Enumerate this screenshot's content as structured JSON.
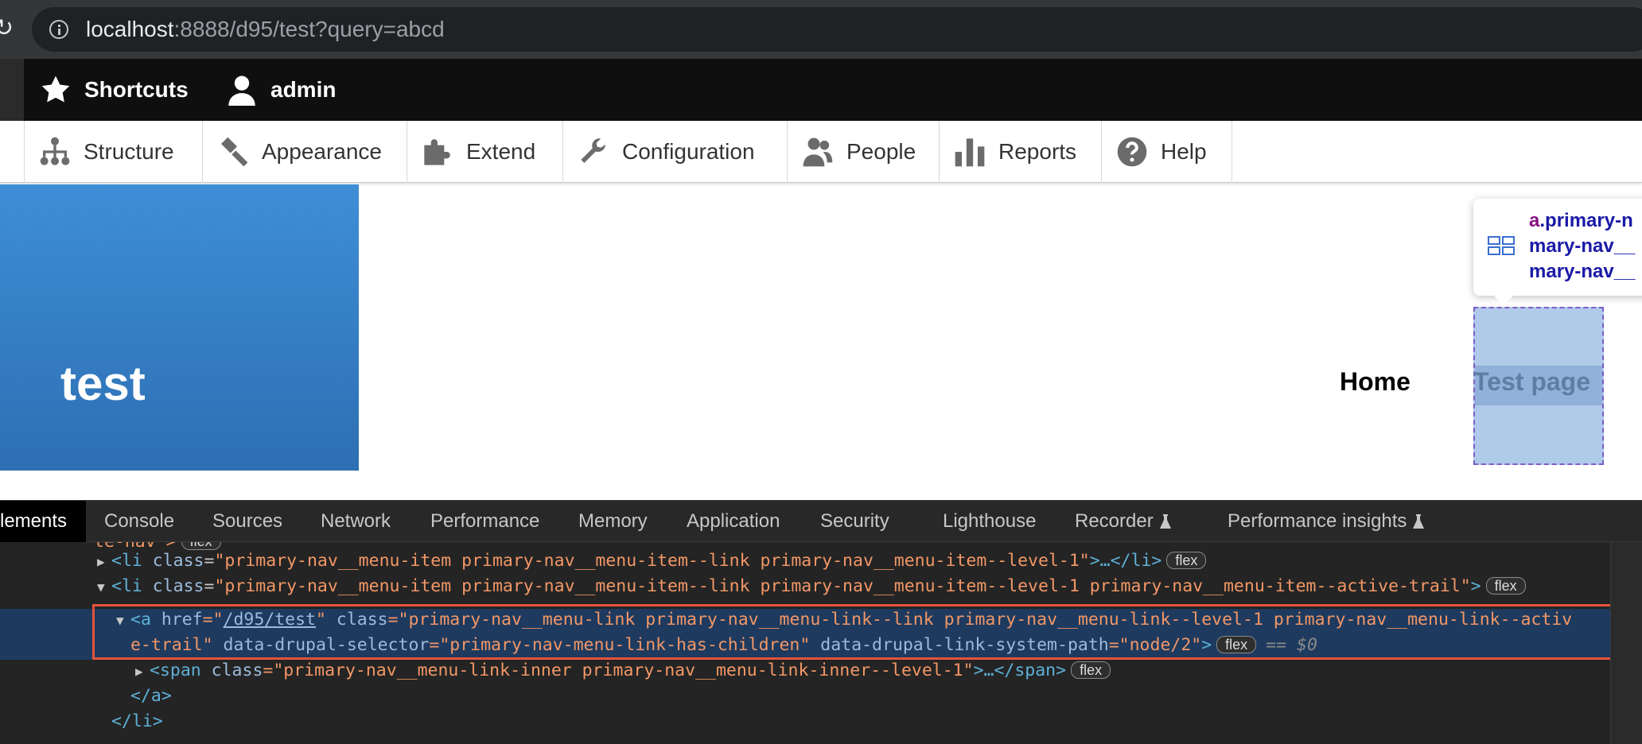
{
  "browser": {
    "url_host": "localhost",
    "url_rest": ":8888/d95/test?query=abcd"
  },
  "toolbar": {
    "shortcuts_label": "Shortcuts",
    "user_label": "admin"
  },
  "tray": {
    "items": [
      {
        "label": "Structure",
        "icon": "structure-icon"
      },
      {
        "label": "Appearance",
        "icon": "appearance-icon"
      },
      {
        "label": "Extend",
        "icon": "extend-icon"
      },
      {
        "label": "Configuration",
        "icon": "configuration-icon"
      },
      {
        "label": "People",
        "icon": "people-icon"
      },
      {
        "label": "Reports",
        "icon": "reports-icon"
      },
      {
        "label": "Help",
        "icon": "help-icon"
      }
    ]
  },
  "site": {
    "name": "test",
    "nav": {
      "home": "Home",
      "test_page": "Test page"
    },
    "accent": "#3a88d1"
  },
  "tooltip": {
    "line1_tag": "a",
    "line1_rest": ".primary-n",
    "line2": "mary-nav__",
    "line3": "mary-nav__"
  },
  "devtools": {
    "tabs": [
      "lements",
      "Console",
      "Sources",
      "Network",
      "Performance",
      "Memory",
      "Application",
      "Security",
      "Lighthouse",
      "Recorder",
      "Performance insights"
    ],
    "lines": {
      "l0_text": "te-nav\">",
      "l0_badge": "flex",
      "l1_open": "<li ",
      "l1_attr": "class",
      "l1_val": "\"primary-nav__menu-item primary-nav__menu-item--link primary-nav__menu-item--level-1\"",
      "l1_tail": ">…</li>",
      "l1_badge": "flex",
      "l2_open": "<li ",
      "l2_attr": "class",
      "l2_val": "\"primary-nav__menu-item primary-nav__menu-item--link primary-nav__menu-item--level-1 primary-nav__menu-item--active-trail\"",
      "l2_tail": ">",
      "l2_badge": "flex",
      "l3_open": "<a ",
      "l3_href_attr": "href",
      "l3_href_q1": "=\"",
      "l3_href_val": "/d95/test",
      "l3_href_q2": "\" ",
      "l3_class_attr": "class",
      "l3_class_val": "=\"primary-nav__menu-link primary-nav__menu-link--link primary-nav__menu-link--level-1 primary-nav__menu-link--activ",
      "l4_class_cont": "e-trail\" ",
      "l4_sel_attr": "data-drupal-selector",
      "l4_sel_val": "=\"primary-nav-menu-link-has-children\" ",
      "l4_path_attr": "data-drupal-link-system-path",
      "l4_path_val": "=\"node/2\"",
      "l4_tail": ">",
      "l4_badge": "flex",
      "l4_ref": "== $0",
      "l5_open": "<span ",
      "l5_attr": "class",
      "l5_val": "=\"primary-nav__menu-link-inner primary-nav__menu-link-inner--level-1\"",
      "l5_tail": ">…</span>",
      "l5_badge": "flex",
      "l6_text": "</a>",
      "l7_text": "</li>"
    },
    "selection_color": "#e5533c"
  }
}
